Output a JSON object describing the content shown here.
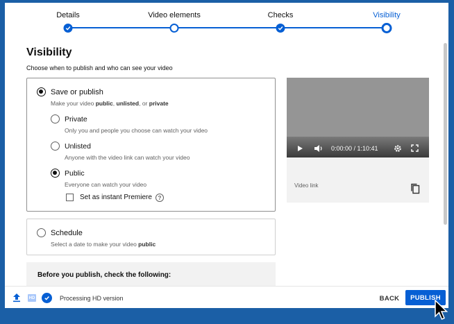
{
  "stepper": {
    "steps": [
      {
        "label": "Details",
        "state": "done"
      },
      {
        "label": "Video elements",
        "state": "current-ring"
      },
      {
        "label": "Checks",
        "state": "done"
      },
      {
        "label": "Visibility",
        "state": "active"
      }
    ]
  },
  "page": {
    "title": "Visibility",
    "subtitle": "Choose when to publish and who can see your video"
  },
  "save_or_publish": {
    "label": "Save or publish",
    "desc_prefix": "Make your video ",
    "desc_public": "public",
    "desc_sep": ", ",
    "desc_unlisted": "unlisted",
    "desc_or": ", or ",
    "desc_private": "private",
    "selected": true,
    "options": [
      {
        "label": "Private",
        "desc": "Only you and people you choose can watch your video",
        "selected": false
      },
      {
        "label": "Unlisted",
        "desc": "Anyone with the video link can watch your video",
        "selected": false
      },
      {
        "label": "Public",
        "desc": "Everyone can watch your video",
        "selected": true
      }
    ],
    "premiere_label": "Set as instant Premiere",
    "premiere_checked": false,
    "help_glyph": "?"
  },
  "schedule": {
    "label": "Schedule",
    "desc_prefix": "Select a date to make your video ",
    "desc_public": "public",
    "selected": false
  },
  "checklist": {
    "title": "Before you publish, check the following:"
  },
  "video": {
    "time": "0:00:00 / 1:10:41",
    "link_label": "Video link",
    "icons": [
      "play-icon",
      "volume-icon",
      "settings-gear-icon",
      "fullscreen-icon",
      "copy-icon"
    ]
  },
  "footer": {
    "hd_badge": "HD",
    "status": "Processing HD version",
    "back_label": "BACK",
    "publish_label": "PUBLISH"
  },
  "colors": {
    "accent": "#065fd4",
    "frame": "#1b5fa6",
    "hd_badge": "#a8c7fa"
  }
}
